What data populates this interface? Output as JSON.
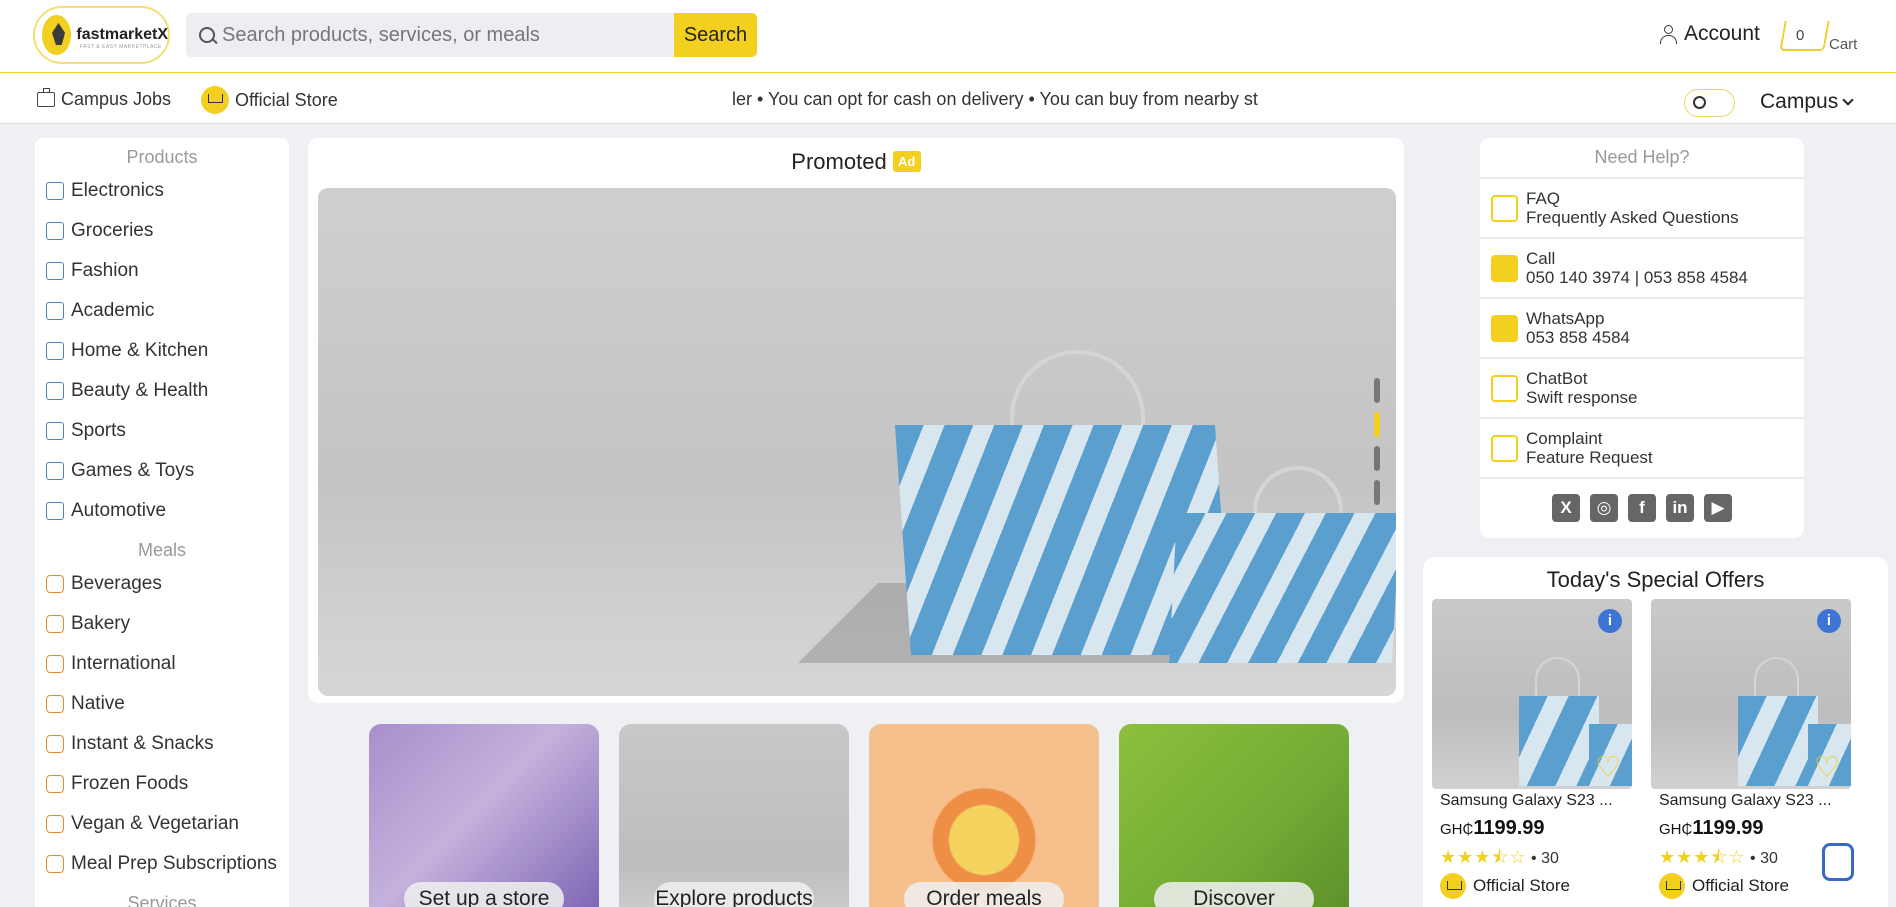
{
  "brand": {
    "name": "fastmarketX",
    "tagline": "FAST & EASY MARKETPLACE"
  },
  "search": {
    "placeholder": "Search products, services, or meals",
    "button_label": "Search"
  },
  "header": {
    "account_label": "Account",
    "cart_count": "0",
    "cart_label": "Cart"
  },
  "subnav": {
    "campus_jobs": "Campus Jobs",
    "official_store": "Official Store",
    "ticker_text": "ler • You can opt for cash on delivery • You can buy from nearby st",
    "location": "Campus"
  },
  "sidebar": {
    "products_heading": "Products",
    "products": [
      {
        "label": "Electronics",
        "icon": "electronics-icon"
      },
      {
        "label": "Groceries",
        "icon": "groceries-icon"
      },
      {
        "label": "Fashion",
        "icon": "shirt-icon"
      },
      {
        "label": "Academic",
        "icon": "academic-icon"
      },
      {
        "label": "Home & Kitchen",
        "icon": "kitchen-icon"
      },
      {
        "label": "Beauty & Health",
        "icon": "beauty-icon"
      },
      {
        "label": "Sports",
        "icon": "dumbbell-icon"
      },
      {
        "label": "Games & Toys",
        "icon": "games-icon"
      },
      {
        "label": "Automotive",
        "icon": "car-icon"
      }
    ],
    "meals_heading": "Meals",
    "meals": [
      {
        "label": "Beverages",
        "icon": "cup-icon"
      },
      {
        "label": "Bakery",
        "icon": "croissant-icon"
      },
      {
        "label": "International",
        "icon": "pizza-icon"
      },
      {
        "label": "Native",
        "icon": "bowl-icon"
      },
      {
        "label": "Instant & Snacks",
        "icon": "snack-icon"
      },
      {
        "label": "Frozen Foods",
        "icon": "ice-cream-icon"
      },
      {
        "label": "Vegan & Vegetarian",
        "icon": "leaf-icon"
      },
      {
        "label": "Meal Prep Subscriptions",
        "icon": "calendar-icon"
      }
    ],
    "services_heading": "Services"
  },
  "promo": {
    "title": "Promoted",
    "badge": "Ad",
    "active_slide": 2,
    "slide_count": 4
  },
  "tiles": [
    {
      "label": "Set up a store"
    },
    {
      "label": "Explore products"
    },
    {
      "label": "Order meals"
    },
    {
      "label": "Discover Services"
    }
  ],
  "help": {
    "heading": "Need Help?",
    "items": [
      {
        "title": "FAQ",
        "subtitle": "Frequently Asked Questions",
        "icon": "faq-icon"
      },
      {
        "title": "Call",
        "subtitle": "050 140 3974 | 053 858 4584",
        "icon": "phone-icon"
      },
      {
        "title": "WhatsApp",
        "subtitle": "053 858 4584",
        "icon": "whatsapp-icon"
      },
      {
        "title": "ChatBot",
        "subtitle": "Swift response",
        "icon": "chatbot-icon"
      },
      {
        "title": "Complaint",
        "subtitle": "Feature Request",
        "icon": "message-icon"
      }
    ],
    "socials": [
      {
        "name": "x-icon",
        "symbol": "X"
      },
      {
        "name": "instagram-icon",
        "symbol": "◎"
      },
      {
        "name": "facebook-icon",
        "symbol": "f"
      },
      {
        "name": "linkedin-icon",
        "symbol": "in"
      },
      {
        "name": "youtube-icon",
        "symbol": "▶"
      }
    ]
  },
  "offers": {
    "title": "Today's Special Offers",
    "products": [
      {
        "name": "Samsung Galaxy S23 ...",
        "currency": "GH₵",
        "price": "1199.99",
        "rating": 3.5,
        "stars": "★★★⯪☆",
        "reviews": "30",
        "store": "Official Store"
      },
      {
        "name": "Samsung Galaxy S23 ...",
        "currency": "GH₵",
        "price": "1199.99",
        "rating": 3.5,
        "stars": "★★★⯪☆",
        "reviews": "30",
        "store": "Official Store"
      }
    ]
  },
  "colors": {
    "accent": "#f3cf1f",
    "blue": "#4b84c6",
    "orange": "#e88b2e",
    "background": "#eef0f4"
  }
}
